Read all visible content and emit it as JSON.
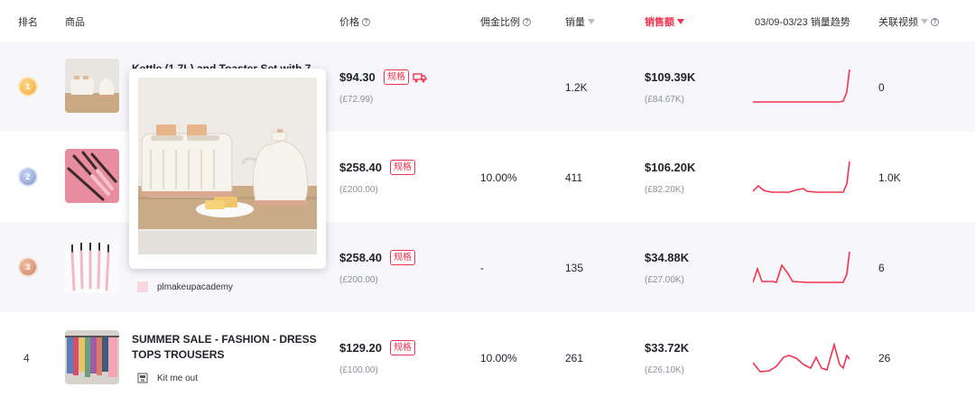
{
  "header": {
    "rank": "排名",
    "product": "商品",
    "price": "价格",
    "commission": "佣金比例",
    "sales": "销量",
    "revenue": "销售额",
    "trend": "03/09-03/23 销量趋势",
    "videos": "关联视频"
  },
  "rows": [
    {
      "rank": "1",
      "title": "Kettle (1.7L) and Toaster Set with 7",
      "price": "$94.30",
      "price_sub": "(£72.99)",
      "tag": "规格",
      "commission": "",
      "sales": "1.2K",
      "amount": "$109.39K",
      "amount_sub": "(£84.67K)",
      "videos": "0"
    },
    {
      "rank": "2",
      "title": "",
      "price": "$258.40",
      "price_sub": "(£200.00)",
      "tag": "规格",
      "commission": "10.00%",
      "sales": "411",
      "amount": "$106.20K",
      "amount_sub": "(£82.20K)",
      "videos": "1.0K"
    },
    {
      "rank": "3",
      "title": "",
      "shop": "plmakeupacademy",
      "price": "$258.40",
      "price_sub": "(£200.00)",
      "tag": "规格",
      "commission": "-",
      "sales": "135",
      "amount": "$34.88K",
      "amount_sub": "(£27.00K)",
      "videos": "6"
    },
    {
      "rank": "4",
      "title_line1": "SUMMER SALE - FASHION - DRESS",
      "title_line2": "TOPS TROUSERS",
      "shop": "Kit me out",
      "price": "$129.20",
      "price_sub": "(£100.00)",
      "tag": "规格",
      "commission": "10.00%",
      "sales": "261",
      "amount": "$33.72K",
      "amount_sub": "(£26.10K)",
      "videos": "26"
    }
  ],
  "colors": {
    "accent": "#f2334f",
    "row_alt": "#f7f7fb",
    "muted": "#8a909a"
  }
}
